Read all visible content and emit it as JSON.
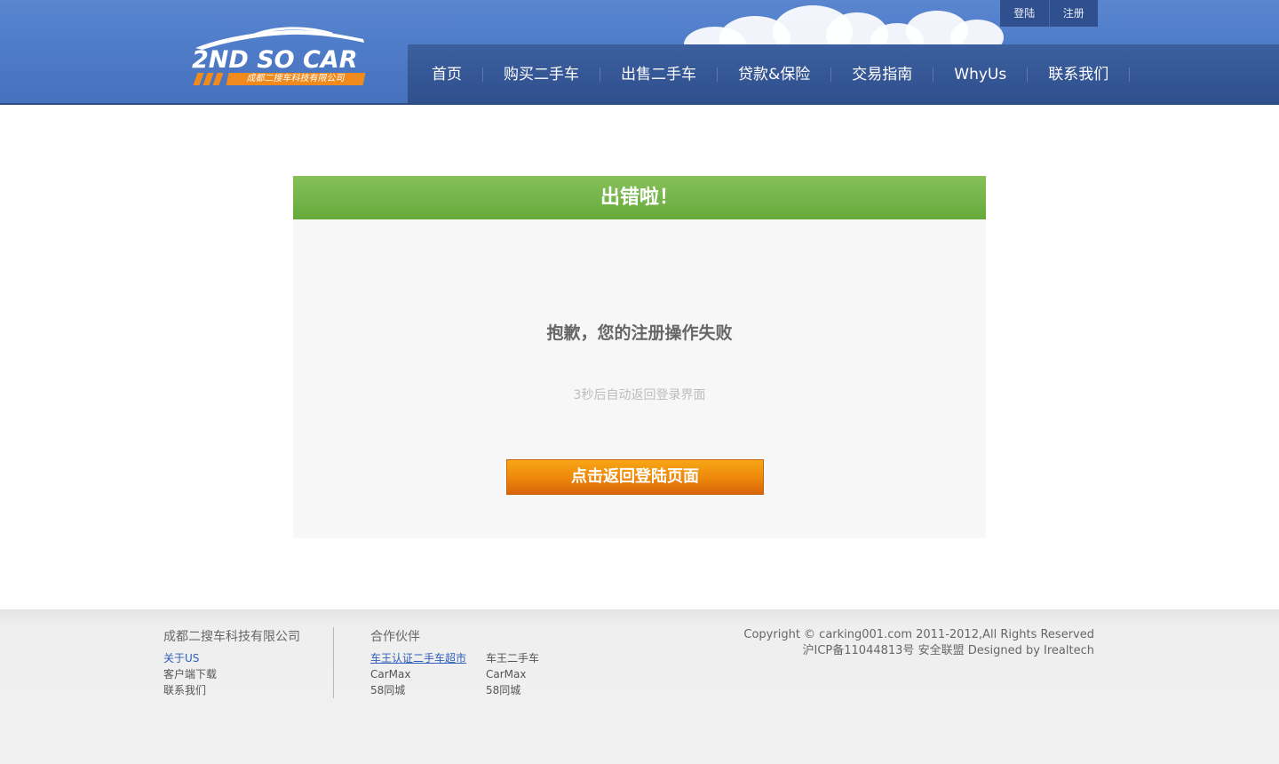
{
  "header": {
    "logo_text": "2ND SO CAR",
    "logo_subtitle": "成都二搜车科技有限公司",
    "top_links": [
      "登陆",
      "注册"
    ],
    "nav": [
      "首页",
      "购买二手车",
      "出售二手车",
      "贷款&保险",
      "交易指南",
      "WhyUs",
      "联系我们"
    ]
  },
  "panel": {
    "title": "出错啦！",
    "message": "抱歉，您的注册操作失败",
    "hint": "3秒后自动返回登录界面",
    "button": "点击返回登陆页面"
  },
  "footer": {
    "company": {
      "heading": "成都二搜车科技有限公司",
      "links": [
        "关于US",
        "客户端下载",
        "联系我们"
      ]
    },
    "partners": {
      "heading": "合作伙伴",
      "col1": [
        "车王认证二手车超市",
        "CarMax",
        "58同城"
      ],
      "col2": [
        "车王二手车",
        "CarMax",
        "58同城"
      ]
    },
    "copyright": "Copyright © carking001.com 2011-2012,All Rights Reserved",
    "icp": "沪ICP备11044813号 安全联盟 Designed by Irealtech"
  },
  "colors": {
    "header_blue": "#4f7cc8",
    "nav_dark": "#2f4f8c",
    "success_green": "#66a93b",
    "button_orange": "#ee8a0b"
  }
}
